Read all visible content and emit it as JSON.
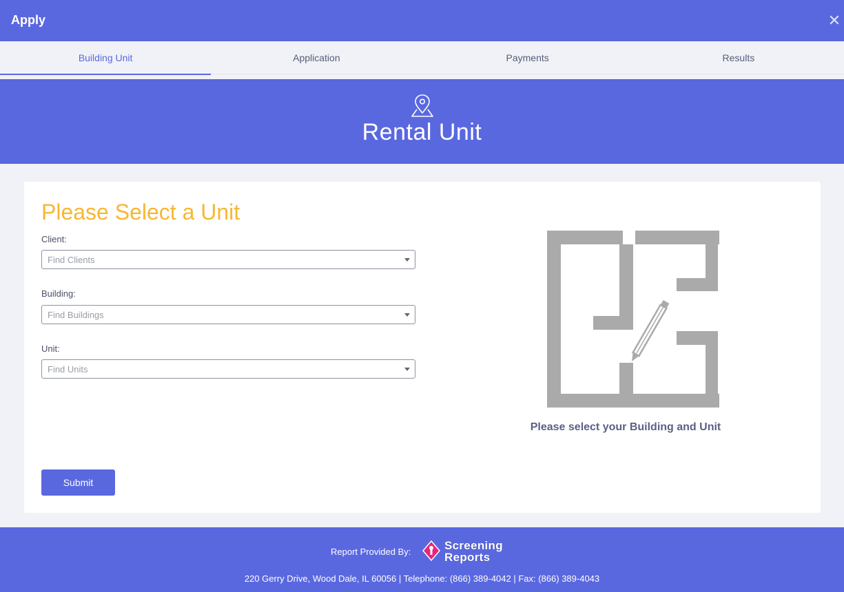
{
  "window": {
    "title": "Apply"
  },
  "tabs": [
    {
      "label": "Building Unit",
      "active": true
    },
    {
      "label": "Application",
      "active": false
    },
    {
      "label": "Payments",
      "active": false
    },
    {
      "label": "Results",
      "active": false
    }
  ],
  "banner": {
    "icon": "map-pin-icon",
    "heading": "Rental Unit"
  },
  "form": {
    "title": "Please Select a Unit",
    "client_label": "Client:",
    "client_placeholder": "Find Clients",
    "building_label": "Building:",
    "building_placeholder": "Find Buildings",
    "unit_label": "Unit:",
    "unit_placeholder": "Find Units",
    "submit_label": "Submit"
  },
  "illustration": {
    "icon": "floor-plan-pencil-icon",
    "message": "Please select your Building and Unit"
  },
  "footer": {
    "provided_by": "Report Provided By:",
    "logo_line1": "Screening",
    "logo_line2": "Reports",
    "address": "220 Gerry Drive, Wood Dale, IL 60056 |   Telephone: (866) 389-4042 |   Fax: (866) 389-4043"
  },
  "colors": {
    "primary": "#5a68e0",
    "accent": "#f7b733",
    "logo_pink": "#e8257d"
  }
}
